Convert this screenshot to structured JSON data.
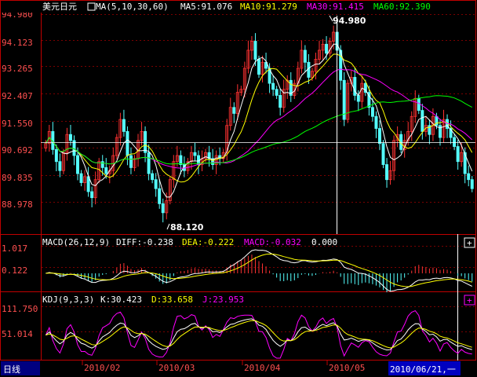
{
  "main": {
    "symbol": "美元日元",
    "ma_header": "MA(5,10,30,60)",
    "ma5": "MA5:91.076",
    "ma10": "MA10:91.279",
    "ma30": "MA30:91.415",
    "ma60": "MA60:92.390",
    "high_marker": "94.980",
    "low_marker": "88.120",
    "y_labels": [
      "94.980",
      "94.123",
      "93.265",
      "92.407",
      "91.550",
      "90.692",
      "89.835",
      "88.978"
    ]
  },
  "macd": {
    "header": "MACD(26,12,9)",
    "diff": "DIFF:-0.238",
    "dea": "DEA:-0.222",
    "macd": "MACD:-0.032",
    "extra": "0.000",
    "y_labels": [
      "1.017",
      "0.122"
    ]
  },
  "kdj": {
    "header": "KDJ(9,3,3)",
    "k": "K:30.423",
    "d": "D:33.658",
    "j": "J:23.953",
    "y_labels": [
      "111.750",
      "51.014"
    ]
  },
  "footer": {
    "period": "日线",
    "dates": [
      "2010/02",
      "2010/03",
      "2010/04",
      "2010/05"
    ],
    "cursor_date": "2010/06/21,一"
  },
  "colors": {
    "up": "#ff3232",
    "down": "#54ffff",
    "ma5": "#ffffff",
    "ma10": "#ffff00",
    "ma30": "#ff00ff",
    "ma60": "#00ff00",
    "axis": "#c00000"
  },
  "chart_data": {
    "type": "candlestick",
    "price_range": [
      88.12,
      94.98
    ],
    "high": 94.98,
    "low": 88.12,
    "closes": [
      90.8,
      91.2,
      90.6,
      90.2,
      89.9,
      90.5,
      91.1,
      90.9,
      90.4,
      89.8,
      89.5,
      89.7,
      89.2,
      89.0,
      89.6,
      90.2,
      90.0,
      89.8,
      89.9,
      90.4,
      91.0,
      91.6,
      91.2,
      90.4,
      90.0,
      90.3,
      90.9,
      91.2,
      90.5,
      89.8,
      89.6,
      89.3,
      88.8,
      88.5,
      88.9,
      89.6,
      90.2,
      90.4,
      90.1,
      89.9,
      90.2,
      90.5,
      90.4,
      90.1,
      90.3,
      90.5,
      90.3,
      90.1,
      90.4,
      90.3,
      90.5,
      91.4,
      92.0,
      91.8,
      92.5,
      92.6,
      93.3,
      93.9,
      94.2,
      93.6,
      93.1,
      93.5,
      93.3,
      92.8,
      92.6,
      92.4,
      92.0,
      92.6,
      92.9,
      92.4,
      92.8,
      93.3,
      93.9,
      93.5,
      93.0,
      93.2,
      93.6,
      93.9,
      94.1,
      93.8,
      94.2,
      94.5,
      93.9,
      92.9,
      91.6,
      92.8,
      93.0,
      92.4,
      92.2,
      92.8,
      92.5,
      92.0,
      91.7,
      91.3,
      90.8,
      90.1,
      89.6,
      89.9,
      90.9,
      91.1,
      90.6,
      90.9,
      91.2,
      91.7,
      92.3,
      91.9,
      91.2,
      91.4,
      91.1,
      91.7,
      91.4,
      91.0,
      91.6,
      91.3,
      91.0,
      90.7,
      90.2,
      90.5,
      89.8,
      89.6,
      89.3
    ],
    "ma5_last": 91.076,
    "ma10_last": 91.279,
    "ma30_last": 91.415,
    "ma60_last": 92.39,
    "macd_range": [
      -0.2,
      1.1
    ],
    "kdj_range": [
      0,
      115
    ]
  }
}
